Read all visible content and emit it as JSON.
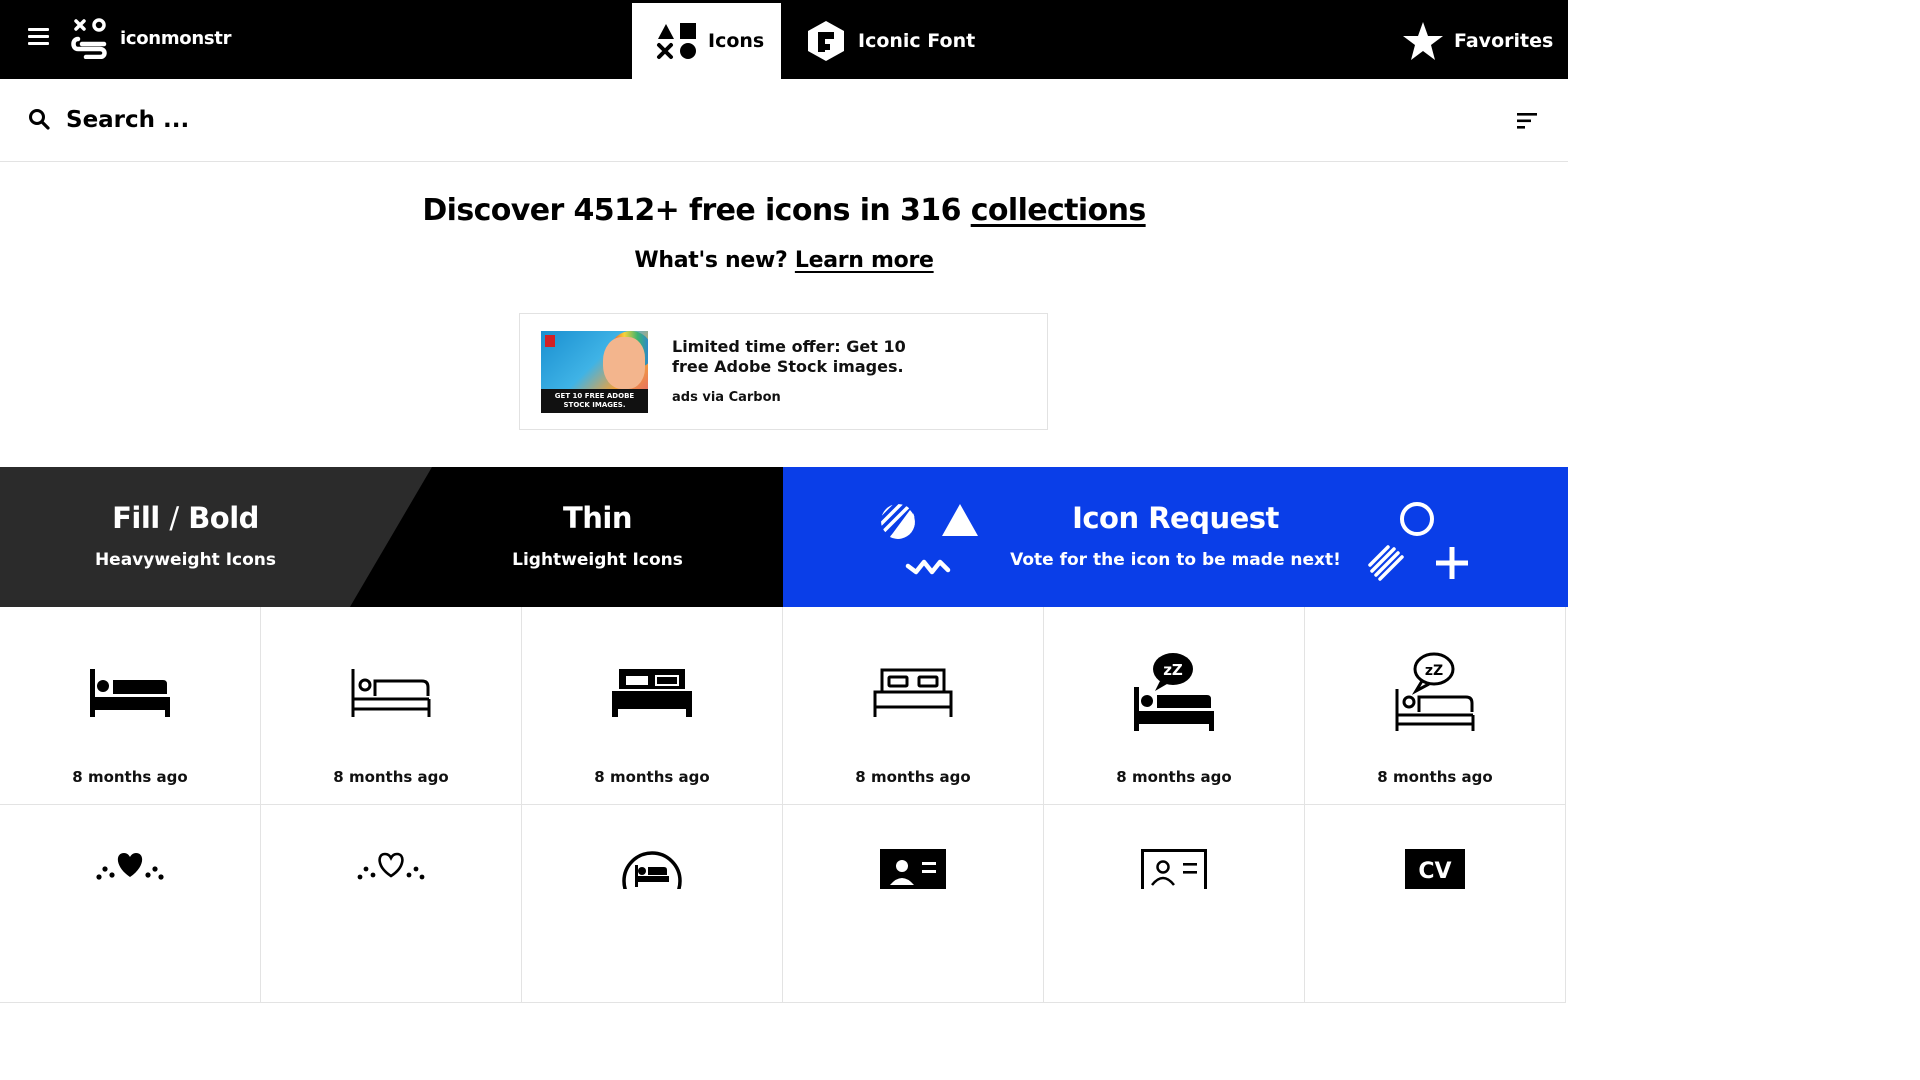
{
  "header": {
    "brand": "iconmonstr",
    "tabs": [
      {
        "label": "Icons",
        "icon": "shapes-icon",
        "active": true
      },
      {
        "label": "Iconic Font",
        "icon": "font-hexagon-icon",
        "active": false
      },
      {
        "label": "Favorites",
        "icon": "star-icon",
        "active": false
      }
    ]
  },
  "search": {
    "placeholder": "Search ..."
  },
  "hero": {
    "title_pre": "Discover 4512+ free icons in 316 ",
    "title_link": "collections",
    "sub_pre": "What's new? ",
    "sub_link": "Learn more"
  },
  "ad": {
    "image_caption": "GET 10 FREE ADOBE STOCK IMAGES.",
    "text": "Limited time offer: Get 10 free Adobe Stock images.",
    "via": "ads via Carbon"
  },
  "banners": {
    "fill": {
      "title_a": "Fill",
      "slash": "/",
      "title_b": "Bold",
      "sub": "Heavyweight Icons"
    },
    "thin": {
      "title": "Thin",
      "sub": "Lightweight Icons"
    },
    "request": {
      "title": "Icon Request",
      "sub": "Vote for the icon to be made next!"
    }
  },
  "icons_row1": [
    {
      "name": "bed-filled-icon",
      "time": "8 months ago"
    },
    {
      "name": "bed-thin-icon",
      "time": "8 months ago"
    },
    {
      "name": "double-bed-filled-icon",
      "time": "8 months ago"
    },
    {
      "name": "double-bed-thin-icon",
      "time": "8 months ago"
    },
    {
      "name": "sleep-bed-filled-icon",
      "time": "8 months ago"
    },
    {
      "name": "sleep-bed-thin-icon",
      "time": "8 months ago"
    }
  ],
  "icons_row2": [
    {
      "name": "heart-dots-filled-icon"
    },
    {
      "name": "heart-dots-thin-icon"
    },
    {
      "name": "bed-circle-icon"
    },
    {
      "name": "id-card-filled-icon"
    },
    {
      "name": "id-card-thin-icon"
    },
    {
      "name": "cv-icon",
      "label": "CV"
    }
  ],
  "colors": {
    "topbar": "#000000",
    "fill_banner": "#2b2b2b",
    "request_banner": "#0a3ee8",
    "text": "#000000"
  }
}
